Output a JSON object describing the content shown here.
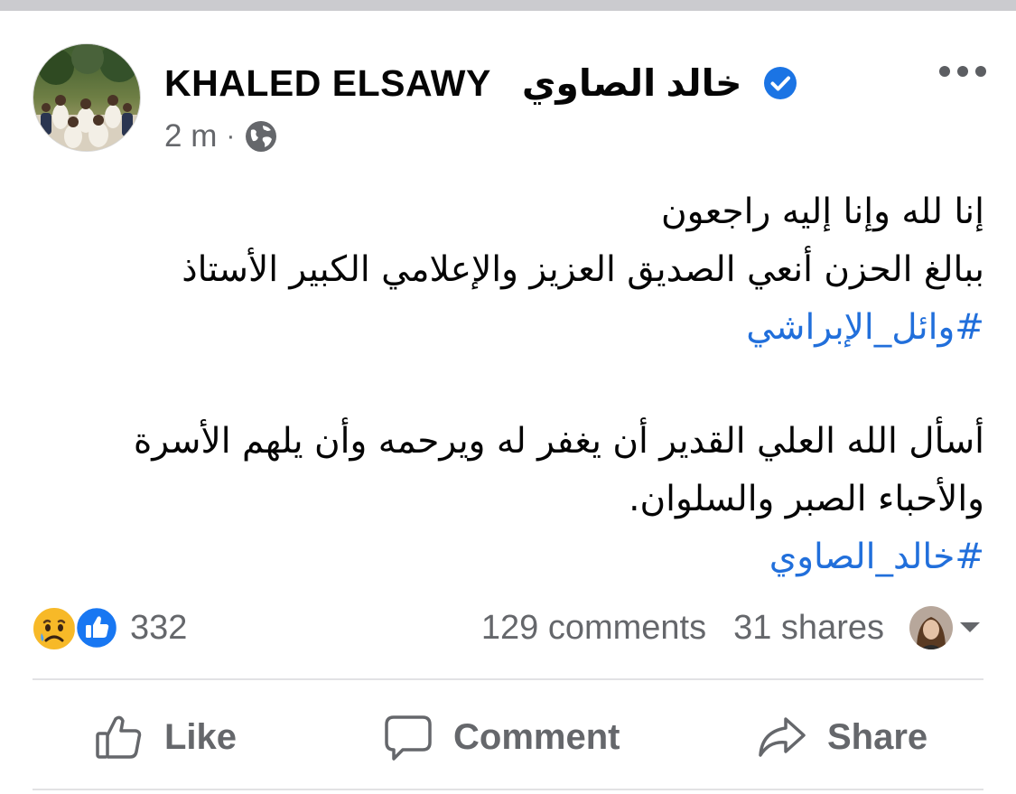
{
  "post": {
    "author_en": "KHALED ELSAWY",
    "author_ar": "خالد الصاوي",
    "time": "2 m",
    "separator": "·",
    "privacy_icon": "globe-icon",
    "verified_icon": "verified-badge-icon",
    "more_icon": "more-options-icon",
    "text_lines": [
      "إنا لله وإنا إليه راجعون",
      "ببالغ الحزن أنعي  الصديق العزيز والإعلامي الكبير الأستاذ"
    ],
    "hashtag_1": "#وائل_الإبراشي",
    "text_lines_2": [
      "أسأل الله العلي القدير أن يغفر له ويرحمه وأن يلهم الأسرة",
      "والأحباء الصبر والسلوان."
    ],
    "hashtag_2": "#خالد_الصاوي"
  },
  "engagement": {
    "reaction_icons": [
      "sad-reaction-icon",
      "like-reaction-icon"
    ],
    "reactions_count": "332",
    "comments": "129 comments",
    "shares": "31 shares"
  },
  "actions": {
    "like": "Like",
    "comment": "Comment",
    "share": "Share"
  },
  "colors": {
    "link": "#216fdb",
    "secondary_text": "#65676b",
    "like_blue": "#1877f2",
    "verified_blue": "#1b74e4"
  }
}
